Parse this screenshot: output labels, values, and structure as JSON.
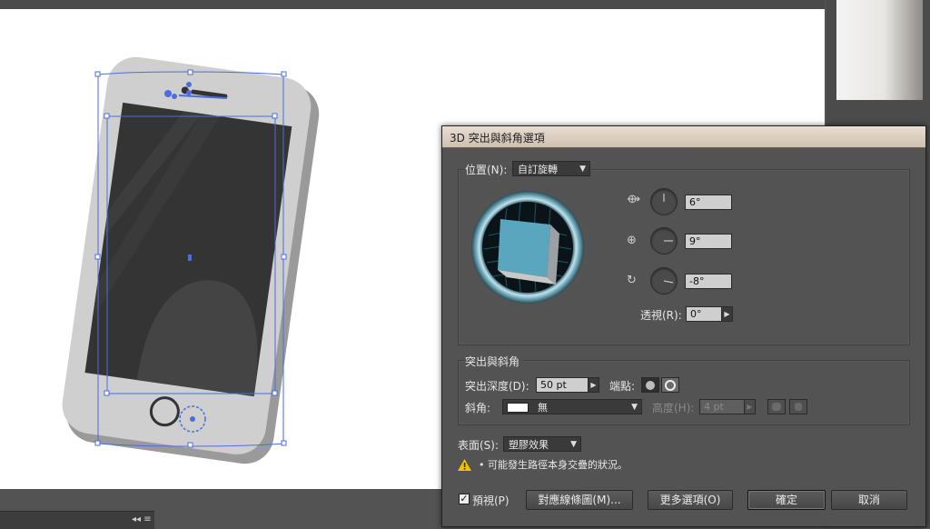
{
  "dialog": {
    "title": "3D 突出與斜角選項",
    "position_label": "位置(N):",
    "position_value": "自訂旋轉",
    "rotation": {
      "x_value": "6°",
      "y_value": "9°",
      "z_value": "-8°",
      "x_icon": "rotate-x-axis-icon",
      "y_icon": "rotate-y-axis-icon",
      "z_icon": "rotate-z-axis-icon"
    },
    "perspective_label": "透視(R):",
    "perspective_value": "0°",
    "extrude_section_title": "突出與斜角",
    "extrude_depth_label": "突出深度(D):",
    "extrude_depth_value": "50 pt",
    "cap_label": "端點:",
    "bevel_label": "斜角:",
    "bevel_value": "無",
    "height_label": "高度(H):",
    "height_value": "4 pt",
    "surface_label": "表面(S):",
    "surface_value": "塑膠效果",
    "warning_text": "• 可能發生路徑本身交疊的狀況。",
    "preview_label": "預視(P)",
    "preview_checked": true,
    "map_art_button": "對應線條圖(M)...",
    "more_options_button": "更多選項(O)",
    "ok_button": "確定",
    "cancel_button": "取消",
    "cube_color": "#5aa6bf",
    "warning_color": "#f2c200"
  },
  "colors": {
    "artboard": "#ffffff",
    "selection": "#4a6ee0",
    "phone_body": "#cfcfcf",
    "phone_screen": "#333333"
  }
}
